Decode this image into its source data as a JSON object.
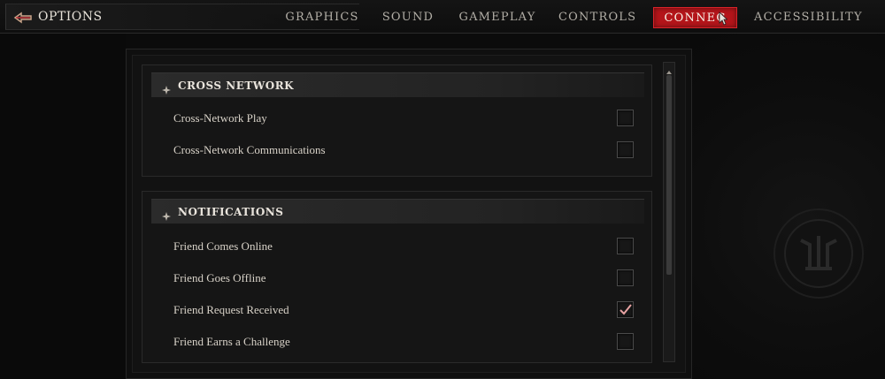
{
  "header": {
    "title": "OPTIONS"
  },
  "tabs": [
    {
      "label": "GRAPHICS",
      "active": false
    },
    {
      "label": "SOUND",
      "active": false
    },
    {
      "label": "GAMEPLAY",
      "active": false
    },
    {
      "label": "CONTROLS",
      "active": false
    },
    {
      "label": "CONNEC",
      "active": true
    },
    {
      "label": "ACCESSIBILITY",
      "active": false
    }
  ],
  "sections": [
    {
      "title": "CROSS NETWORK",
      "items": [
        {
          "label": "Cross-Network Play",
          "checked": false
        },
        {
          "label": "Cross-Network Communications",
          "checked": false
        }
      ]
    },
    {
      "title": "NOTIFICATIONS",
      "items": [
        {
          "label": "Friend Comes Online",
          "checked": false
        },
        {
          "label": "Friend Goes Offline",
          "checked": false
        },
        {
          "label": "Friend Request Received",
          "checked": true
        },
        {
          "label": "Friend Earns a Challenge",
          "checked": false
        }
      ]
    }
  ],
  "colors": {
    "accent_red": "#b4151a",
    "checkmark": "#e8a3a3",
    "text": "#d8d2c8"
  },
  "icons": {
    "back": "back-arrow-icon",
    "section": "diamond-icon",
    "checkmark": "checkmark-icon",
    "cursor": "cursor-icon",
    "emblem": "emblem-icon"
  }
}
